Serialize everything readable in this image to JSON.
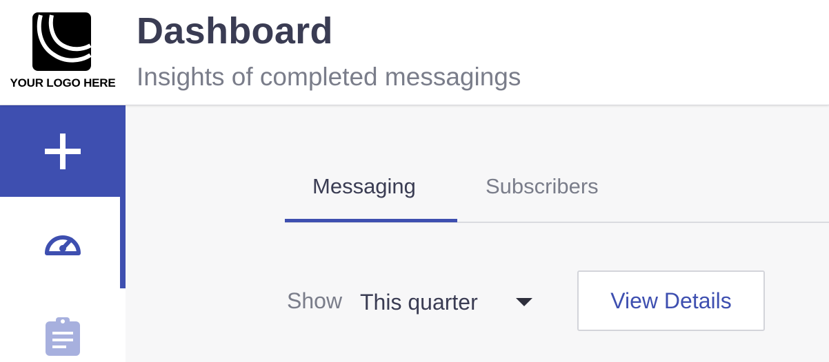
{
  "header": {
    "logo": {
      "text": "YOUR LOGO HERE",
      "icon": "logo-mark"
    },
    "title": "Dashboard",
    "subtitle": "Insights of completed messagings"
  },
  "sidebar": {
    "items": [
      {
        "icon": "plus-icon",
        "active": false
      },
      {
        "icon": "speedometer-icon",
        "active": true
      },
      {
        "icon": "clipboard-icon",
        "active": false
      }
    ]
  },
  "main": {
    "tabs": [
      {
        "label": "Messaging",
        "active": true
      },
      {
        "label": "Subscribers",
        "active": false
      }
    ],
    "filter": {
      "label": "Show",
      "value": "This quarter"
    },
    "view_details_label": "View Details"
  },
  "colors": {
    "accent": "#3e4fb0",
    "title": "#3a3c53",
    "muted": "#7a7d8a",
    "background": "#f7f7f8"
  }
}
